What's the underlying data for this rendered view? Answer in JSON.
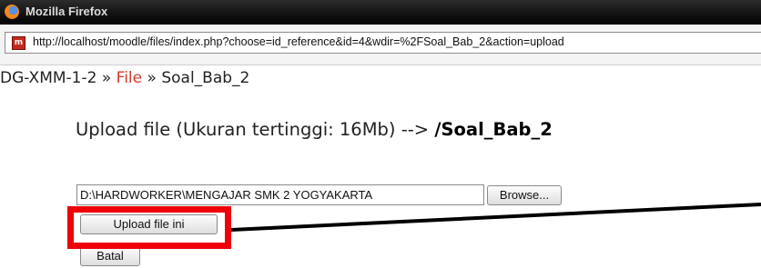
{
  "window": {
    "title": "Mozilla Firefox"
  },
  "addressbar": {
    "site_icon_text": "m",
    "url": "http://localhost/moodle/files/index.php?choose=id_reference&id=4&wdir=%2FSoal_Bab_2&action=upload"
  },
  "breadcrumb": {
    "course": "DG-XMM-1-2",
    "sep1": " » ",
    "files_link": "File",
    "sep2": " » ",
    "folder": "Soal_Bab_2"
  },
  "upload": {
    "heading_prefix": "Upload file (Ukuran tertinggi: 16Mb) --> ",
    "heading_path": "/Soal_Bab_2",
    "file_value": "D:\\HARDWORKER\\MENGAJAR SMK 2 YOGYAKARTA",
    "browse_label": "Browse...",
    "upload_label": "Upload file ini",
    "cancel_label": "Batal"
  },
  "annotation": {
    "highlight_color": "#ee0008",
    "arrow_color": "#000000"
  }
}
